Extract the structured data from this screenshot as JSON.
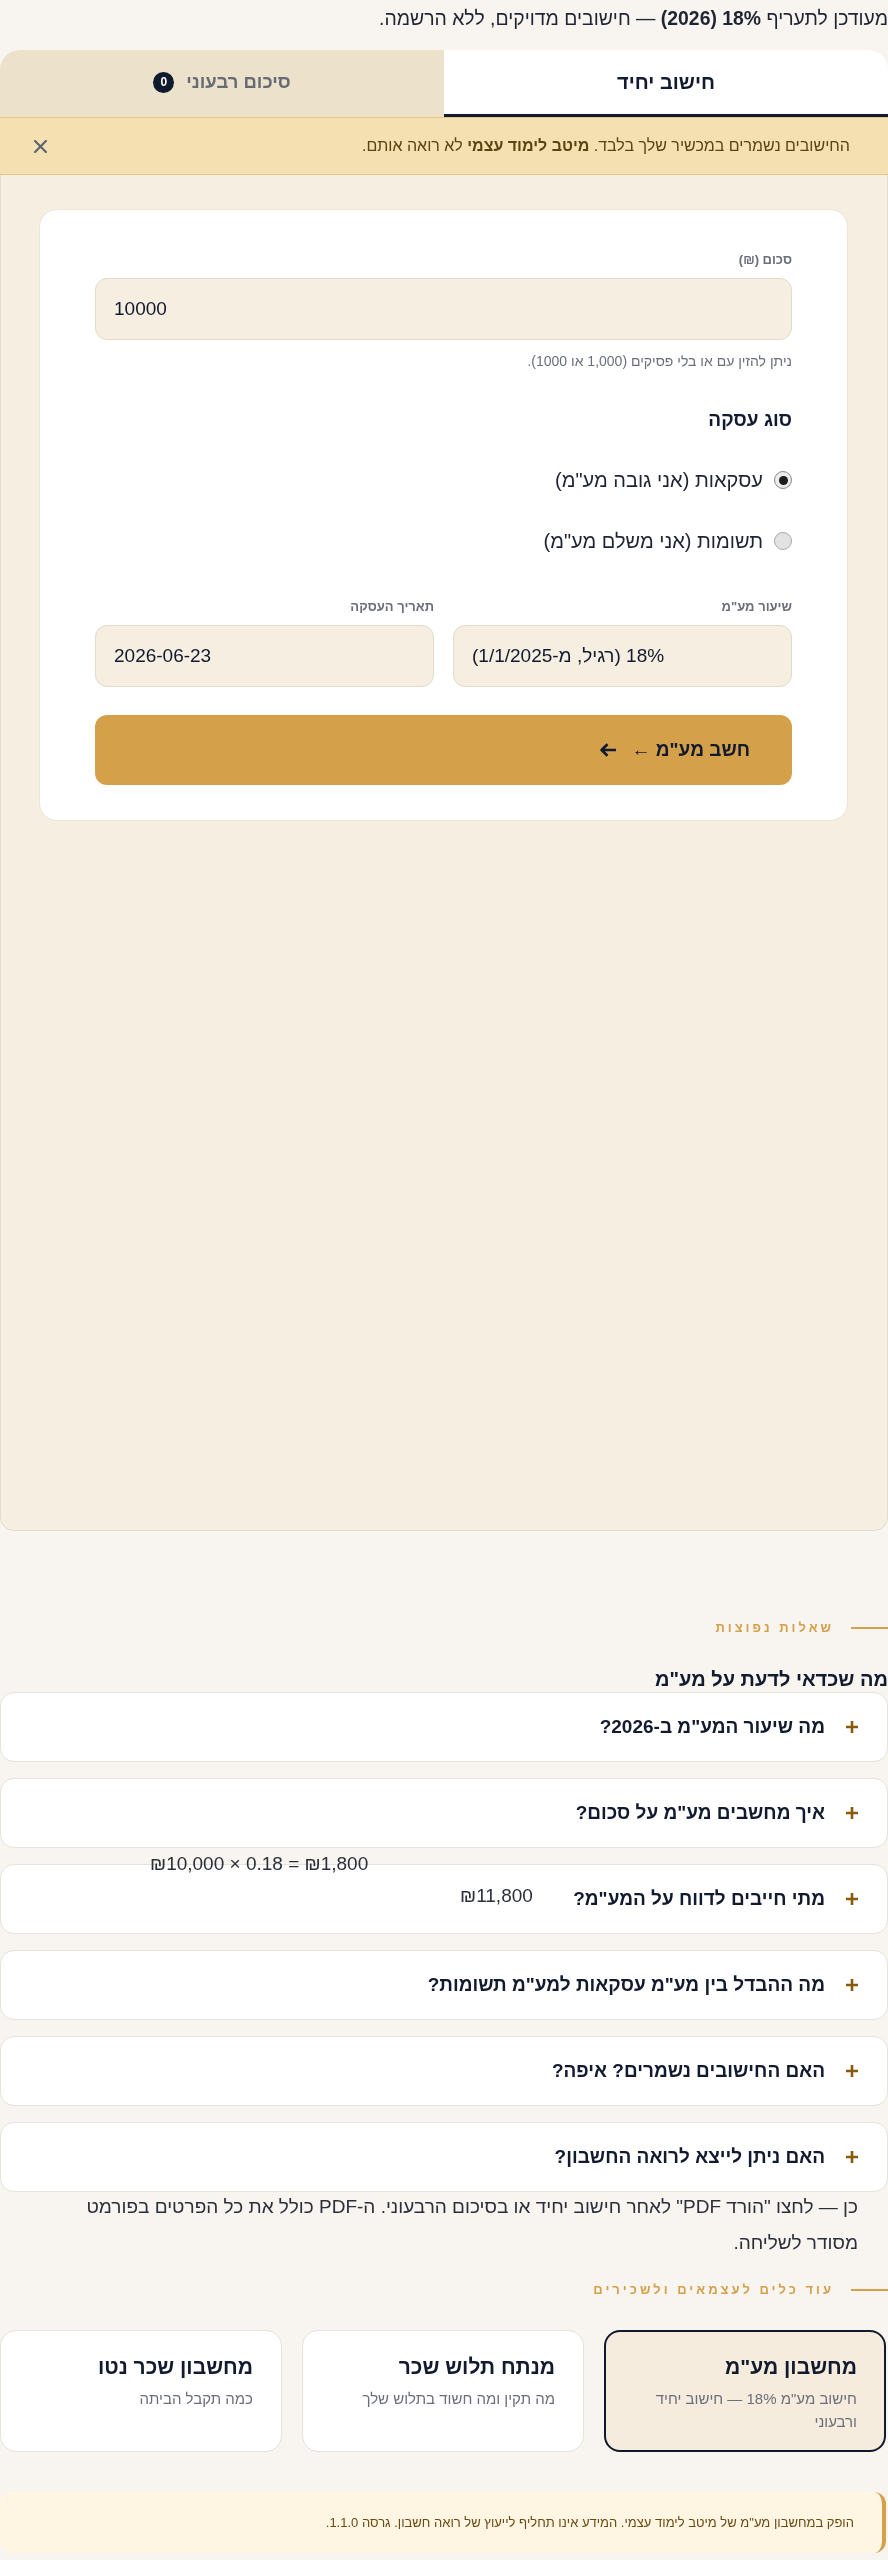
{
  "intro": "מעודכן לתעריף **18% (2026)** — חישובים מדויקים, ללא הרשמה.",
  "tabs": [
    {
      "label": "חישוב יחיד",
      "selected": true
    },
    {
      "label": "סיכום רבעוני",
      "badge": "0",
      "selected": false
    }
  ],
  "notice": {
    "text": "החישובים נשמרים במכשיר שלך בלבד. **מיטב לימוד עצמי** לא רואה אותם."
  },
  "form": {
    "amount": {
      "label": "סכום (₪)",
      "value": "10000",
      "hint": "ניתן להזין עם או בלי פסיקים (1,000 או 1000)."
    },
    "transaction_type": {
      "title": "סוג עסקה",
      "options": [
        {
          "label": "עסקאות (אני גובה מע\"מ)",
          "selected": true
        },
        {
          "label": "תשומות (אני משלם מע\"מ)",
          "selected": false
        }
      ]
    },
    "rate": {
      "label": "שיעור מע\"מ",
      "value": "18% (רגיל, מ-1/1/2025)"
    },
    "date": {
      "label": "תאריך העסקה",
      "value": "2026-06-23"
    },
    "submit": {
      "label": "חשב מע\"מ ←"
    }
  },
  "faq": {
    "eyebrow": "שאלות נפוצות",
    "title": "מה שכדאי לדעת על מע\"מ",
    "items": [
      {
        "question": "מה שיעור המע\"מ ב-2026?"
      },
      {
        "question": "איך מחשבים מע\"מ על סכום?",
        "answer_parts": [
          "₪10,000 × 0.18 = ₪1,800",
          "₪11,800"
        ]
      },
      {
        "question": "מתי חייבים לדווח על המע\"מ?"
      },
      {
        "question": "מה ההבדל בין מע\"מ עסקאות למע\"מ תשומות?"
      },
      {
        "question": "האם החישובים נשמרים? איפה?"
      },
      {
        "question": "האם ניתן לייצא לרואה החשבון?",
        "answer": "כן — לחצו \"הורד PDF\" לאחר חישוב יחיד או בסיכום הרבעוני. ה-PDF כולל את כל הפרטים בפורמט מסודר לשליחה."
      }
    ]
  },
  "tools": {
    "eyebrow": "עוד כלים לעצמאים ולשכירים",
    "items": [
      {
        "title": "מחשבון מע\"מ",
        "subtitle": "חישוב מע\"מ 18% — חישוב יחיד ורבעוני",
        "selected": true
      },
      {
        "title": "מנתח תלוש שכר",
        "subtitle": "מה תקין ומה חשוד בתלוש שלך",
        "selected": false
      },
      {
        "title": "מחשבון שכר נטו",
        "subtitle": "כמה תקבל הביתה",
        "selected": false
      }
    ]
  },
  "footer": "הופק במחשבון מע\"מ של מיטב לימוד עצמי. המידע אינו תחליף לייעוץ של רואה חשבון. גרסה 1.1.0."
}
